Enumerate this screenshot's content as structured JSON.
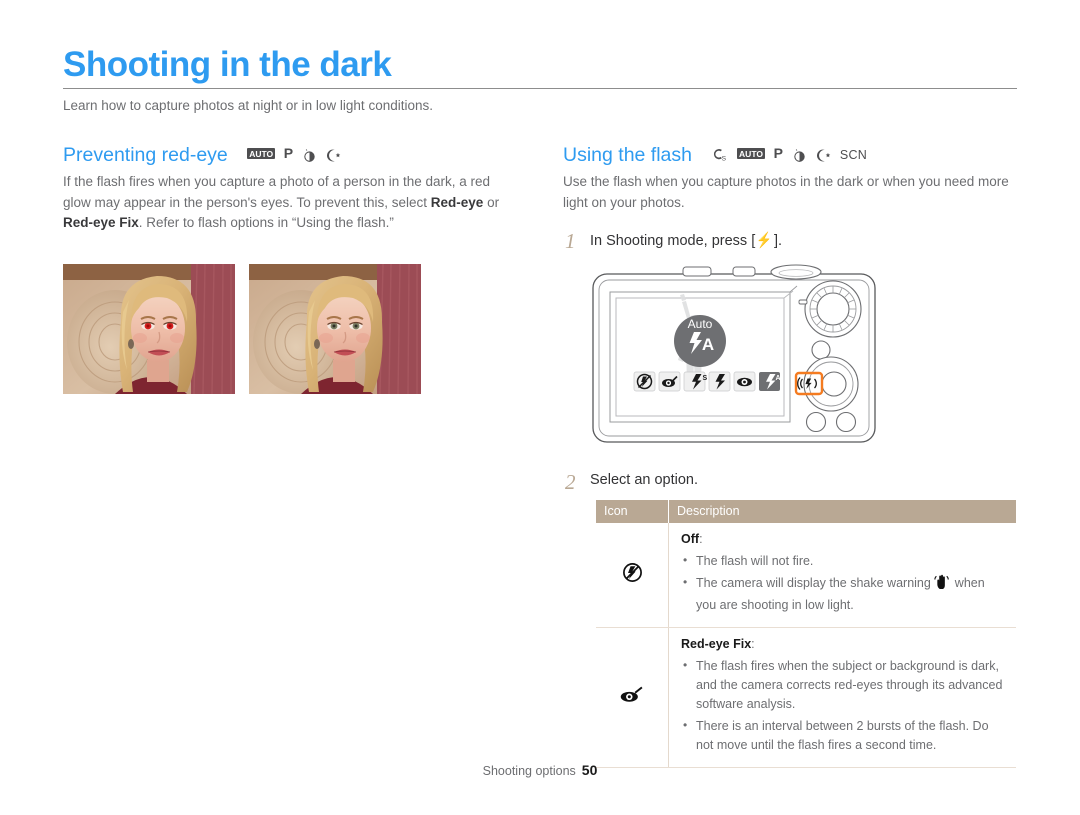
{
  "document": {
    "title": "Shooting in the dark",
    "intro": "Learn how to capture photos at night or in low light conditions.",
    "footer": {
      "section": "Shooting options",
      "page_number": "50"
    },
    "colors": {
      "heading_blue": "#2e9bf0",
      "table_header_brown": "#b9a894",
      "body_gray": "#6d6e71",
      "highlight_orange": "#f47b20"
    }
  },
  "left_column": {
    "heading": "Preventing red-eye",
    "mode_icons": [
      "AUTO",
      "P",
      "night-mode-icon",
      "moon-star-icon"
    ],
    "paragraph_part1": "If the flash fires when you capture a photo of a person in the dark, a red glow may appear in the person's eyes. To prevent this, select ",
    "bold1": "Red-eye",
    "paragraph_part2": " or ",
    "bold2": "Red-eye Fix",
    "paragraph_part3": ". Refer to flash options in “Using the flash.”",
    "images": [
      {
        "name": "red-eye-photo",
        "caption": ""
      },
      {
        "name": "corrected-photo",
        "caption": ""
      }
    ]
  },
  "right_column": {
    "heading": "Using the flash",
    "mode_icons": [
      "smart-auto-icon",
      "AUTO",
      "P",
      "night-mode-icon",
      "moon-star-icon",
      "SCN"
    ],
    "paragraph": "Use the flash when you capture photos in the dark or when you need more light on your photos.",
    "steps": [
      {
        "number": "1",
        "text_before": "In Shooting mode, press [",
        "icon": "flash-icon",
        "text_after": "]."
      },
      {
        "number": "2",
        "text_before": "Select an option.",
        "icon": "",
        "text_after": ""
      }
    ],
    "camera": {
      "lcd_overlay_label": "Auto",
      "lcd_overlay_icon": "flash-auto-icon",
      "flash_options_bar": [
        "flash-off-icon",
        "red-eye-fix-icon",
        "slow-sync-icon",
        "fill-in-icon",
        "red-eye-icon",
        "flash-auto-icon"
      ],
      "selected_option_index": 5,
      "highlighted_button": "flash-button"
    },
    "table": {
      "headers": [
        "Icon",
        "Description"
      ],
      "rows": [
        {
          "icon": "flash-off-icon",
          "title": "Off",
          "bullets": [
            "The flash will not fire.",
            "The camera will display the shake warning  when you are shooting in low light."
          ],
          "bullet_parts": [
            {
              "text": "The flash will not fire."
            },
            {
              "text_before": "The camera will display the shake warning ",
              "inline_icon": "shake-warning-icon",
              "text_after": " when you are shooting in low light."
            }
          ]
        },
        {
          "icon": "red-eye-fix-icon",
          "title": "Red-eye Fix",
          "bullets": [
            "The flash fires when the subject or background is dark, and the camera corrects red-eyes through its advanced software analysis.",
            "There is an interval between 2 bursts of the flash. Do not move until the flash fires a second time."
          ],
          "bullet_parts": [
            {
              "text": "The flash fires when the subject or background is dark, and the camera corrects red-eyes through its advanced software analysis."
            },
            {
              "text": "There is an interval between 2 bursts of the flash. Do not move until the flash fires a second time."
            }
          ]
        }
      ]
    }
  }
}
